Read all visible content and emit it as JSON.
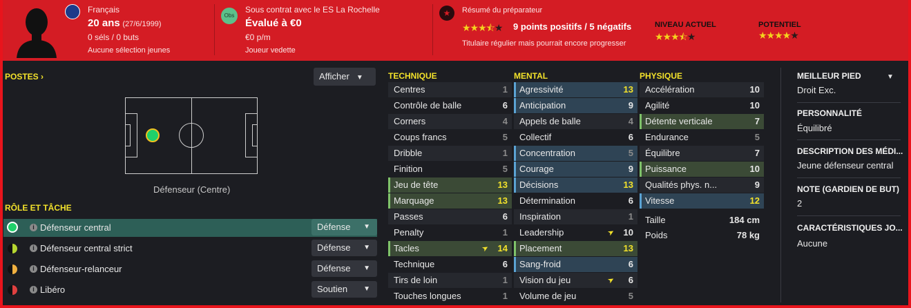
{
  "header": {
    "nationality": "Français",
    "age": "20 ans",
    "dob": "(27/6/1999)",
    "caps": "0 séls / 0 buts",
    "youth_caps": "Aucune sélection jeunes",
    "obs_badge": "Obs",
    "contract": "Sous contrat avec le ES La Rochelle",
    "value": "Évalué à €0",
    "wage": "€0 p/m",
    "status": "Joueur vedette",
    "report_title": "Résumé du préparateur",
    "report_summary": "9 points positifs / 5 négatifs",
    "report_stars": 3.5,
    "report_note": "Titulaire régulier mais pourrait encore progresser",
    "current_label": "NIVEAU ACTUEL",
    "current_stars": 3.5,
    "potential_label": "POTENTIEL",
    "potential_stars": 4,
    "colors": {
      "header_bg": "#d41c24",
      "star": "#f4d21e"
    }
  },
  "positions": {
    "title": "POSTES ›",
    "show_button": "Afficher",
    "pitch_label": "Défenseur (Centre)"
  },
  "roles": {
    "title": "RÔLE ET TÂCHE",
    "items": [
      {
        "label": "Défenseur central",
        "duty": "Défense",
        "dot": "green"
      },
      {
        "label": "Défenseur central strict",
        "duty": "Défense",
        "dot": "half-lime"
      },
      {
        "label": "Défenseur-relanceur",
        "duty": "Défense",
        "dot": "half-orange"
      },
      {
        "label": "Libéro",
        "duty": "Soutien",
        "dot": "half-red"
      }
    ]
  },
  "technique": {
    "title": "TECHNIQUE",
    "items": [
      {
        "label": "Centres",
        "value": "1"
      },
      {
        "label": "Contrôle de balle",
        "value": "6"
      },
      {
        "label": "Corners",
        "value": "4"
      },
      {
        "label": "Coups francs",
        "value": "5"
      },
      {
        "label": "Dribble",
        "value": "1"
      },
      {
        "label": "Finition",
        "value": "5"
      },
      {
        "label": "Jeu de tête",
        "value": "13",
        "hl": "green"
      },
      {
        "label": "Marquage",
        "value": "13",
        "hl": "green"
      },
      {
        "label": "Passes",
        "value": "6"
      },
      {
        "label": "Penalty",
        "value": "1"
      },
      {
        "label": "Tacles",
        "value": "14",
        "hl": "green",
        "arrow": true
      },
      {
        "label": "Technique",
        "value": "6"
      },
      {
        "label": "Tirs de loin",
        "value": "1"
      },
      {
        "label": "Touches longues",
        "value": "1"
      }
    ]
  },
  "mental": {
    "title": "MENTAL",
    "items": [
      {
        "label": "Agressivité",
        "value": "13",
        "hl": "blue"
      },
      {
        "label": "Anticipation",
        "value": "9",
        "hl": "blue"
      },
      {
        "label": "Appels de balle",
        "value": "4"
      },
      {
        "label": "Collectif",
        "value": "6"
      },
      {
        "label": "Concentration",
        "value": "5",
        "hl": "blue"
      },
      {
        "label": "Courage",
        "value": "9",
        "hl": "blue"
      },
      {
        "label": "Décisions",
        "value": "13",
        "hl": "blue"
      },
      {
        "label": "Détermination",
        "value": "6"
      },
      {
        "label": "Inspiration",
        "value": "1"
      },
      {
        "label": "Leadership",
        "value": "10",
        "arrow": true
      },
      {
        "label": "Placement",
        "value": "13",
        "hl": "green"
      },
      {
        "label": "Sang-froid",
        "value": "6",
        "hl": "blue"
      },
      {
        "label": "Vision du jeu",
        "value": "6",
        "arrow": true
      },
      {
        "label": "Volume de jeu",
        "value": "5"
      }
    ]
  },
  "physique": {
    "title": "PHYSIQUE",
    "items": [
      {
        "label": "Accélération",
        "value": "10"
      },
      {
        "label": "Agilité",
        "value": "10"
      },
      {
        "label": "Détente verticale",
        "value": "7",
        "hl": "green"
      },
      {
        "label": "Endurance",
        "value": "5"
      },
      {
        "label": "Équilibre",
        "value": "7"
      },
      {
        "label": "Puissance",
        "value": "10",
        "hl": "green"
      },
      {
        "label": "Qualités phys. n...",
        "value": "9"
      },
      {
        "label": "Vitesse",
        "value": "12",
        "hl": "blue"
      }
    ],
    "height_label": "Taille",
    "height_value": "184 cm",
    "weight_label": "Poids",
    "weight_value": "78 kg"
  },
  "info": {
    "foot_title": "MEILLEUR PIED",
    "foot_value": "Droit Exc.",
    "personality_title": "PERSONNALITÉ",
    "personality_value": "Équilibré",
    "media_title": "DESCRIPTION DES MÉDI...",
    "media_value": "Jeune défenseur central",
    "gk_title": "NOTE (GARDIEN DE BUT)",
    "gk_value": "2",
    "traits_title": "CARACTÉRISTIQUES JO...",
    "traits_value": "Aucune"
  }
}
